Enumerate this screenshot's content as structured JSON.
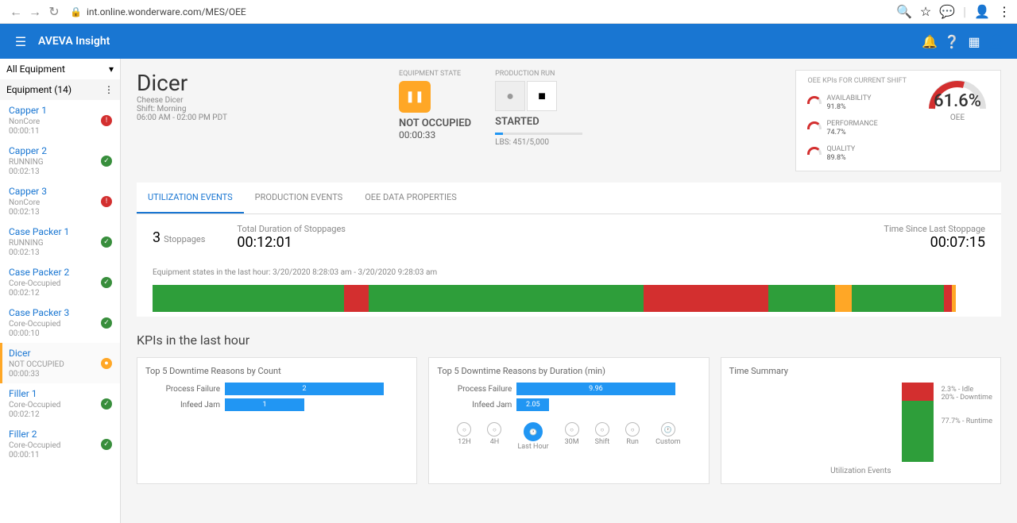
{
  "browser": {
    "url": "int.online.wonderware.com/MES/OEE"
  },
  "header": {
    "brand": "AVEVA Insight"
  },
  "sidebar": {
    "filter": "All Equipment",
    "section": "Equipment (14)",
    "items": [
      {
        "name": "Capper 1",
        "status": "NonCore",
        "time": "00:00:11",
        "badge": "error"
      },
      {
        "name": "Capper 2",
        "status": "RUNNING",
        "time": "00:02:13",
        "badge": "ok"
      },
      {
        "name": "Capper 3",
        "status": "NonCore",
        "time": "00:02:13",
        "badge": "error"
      },
      {
        "name": "Case Packer 1",
        "status": "RUNNING",
        "time": "00:02:13",
        "badge": "ok"
      },
      {
        "name": "Case Packer 2",
        "status": "Core-Occupied",
        "time": "00:02:12",
        "badge": "ok"
      },
      {
        "name": "Case Packer 3",
        "status": "Core-Occupied",
        "time": "00:00:10",
        "badge": "ok"
      },
      {
        "name": "Dicer",
        "status": "NOT OCCUPIED",
        "time": "00:00:33",
        "badge": "warn",
        "active": true
      },
      {
        "name": "Filler 1",
        "status": "Core-Occupied",
        "time": "00:02:12",
        "badge": "ok"
      },
      {
        "name": "Filler 2",
        "status": "Core-Occupied",
        "time": "00:00:11",
        "badge": "ok"
      }
    ]
  },
  "title": {
    "name": "Dicer",
    "desc": "Cheese Dicer",
    "shift": "Shift: Morning",
    "hours": "06:00 AM - 02:00 PM PDT"
  },
  "equipment_state": {
    "label": "EQUIPMENT STATE",
    "status": "NOT OCCUPIED",
    "time": "00:00:33"
  },
  "production_run": {
    "label": "PRODUCTION RUN",
    "status": "STARTED",
    "lbs": "LBS: 451/5,000"
  },
  "kpis": {
    "header": "OEE KPIs FOR CURRENT SHIFT",
    "availability_label": "AVAILABILITY",
    "availability": "91.8%",
    "performance_label": "PERFORMANCE",
    "performance": "74.7%",
    "quality_label": "QUALITY",
    "quality": "89.8%",
    "oee": "61.6%",
    "oee_label": "OEE"
  },
  "tabs": [
    "UTILIZATION EVENTS",
    "PRODUCTION EVENTS",
    "OEE DATA PROPERTIES"
  ],
  "stoppages": {
    "count": "3",
    "count_label": "Stoppages",
    "duration_label": "Total Duration of Stoppages",
    "duration": "00:12:01",
    "since_label": "Time Since Last Stoppage",
    "since": "00:07:15"
  },
  "timeline_note": "Equipment states in the last hour: 3/20/2020 8:28:03 am - 3/20/2020 9:28:03 am",
  "kpi_section_title": "KPIs in the last hour",
  "chart_data": {
    "downtime_by_count": {
      "type": "bar",
      "title": "Top 5 Downtime Reasons by Count",
      "categories": [
        "Process Failure",
        "Infeed Jam"
      ],
      "values": [
        2,
        1
      ]
    },
    "downtime_by_duration": {
      "type": "bar",
      "title": "Top 5 Downtime Reasons by Duration (min)",
      "categories": [
        "Process Failure",
        "Infeed Jam"
      ],
      "values": [
        9.96,
        2.05
      ]
    },
    "time_summary": {
      "type": "stacked",
      "title": "Time Summary",
      "series": [
        {
          "name": "Idle",
          "pct": 2.3
        },
        {
          "name": "Downtime",
          "pct": 20
        },
        {
          "name": "Runtime",
          "pct": 77.7
        }
      ],
      "caption": "Utilization Events",
      "legend1": "2.3% - Idle",
      "legend2": "20% - Downtime",
      "legend3": "77.7% - Runtime"
    },
    "timeline_segments": [
      {
        "color": "#2e9e3a",
        "pct": 20
      },
      {
        "color": "#2e9e3a",
        "pct": 3
      },
      {
        "color": "#d32f2f",
        "pct": 3
      },
      {
        "color": "#2e9e3a",
        "pct": 30
      },
      {
        "color": "#2e9e3a",
        "pct": 3
      },
      {
        "color": "#d32f2f",
        "pct": 15
      },
      {
        "color": "#2e9e3a",
        "pct": 8
      },
      {
        "color": "#ffa726",
        "pct": 2
      },
      {
        "color": "#2e9e3a",
        "pct": 2
      },
      {
        "color": "#2e9e3a",
        "pct": 9
      },
      {
        "color": "#d32f2f",
        "pct": 1
      },
      {
        "color": "#ffa726",
        "pct": 0.5
      }
    ]
  },
  "time_range": [
    "12H",
    "4H",
    "Last Hour",
    "30M",
    "Shift",
    "Run",
    "Custom"
  ]
}
